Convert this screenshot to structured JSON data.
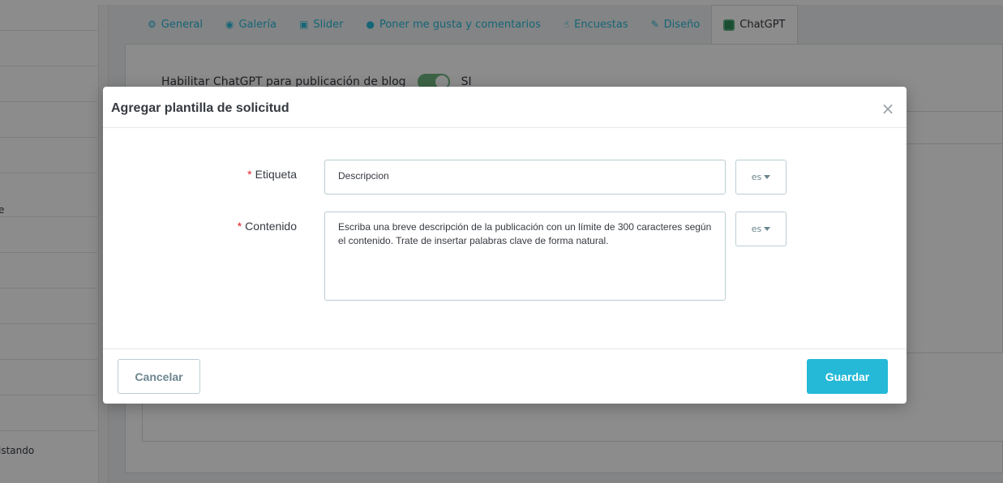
{
  "background": {
    "sidebar_partial_labels": [
      "e",
      "istando"
    ],
    "tabs": [
      {
        "label": "General",
        "icon": "gear-icon"
      },
      {
        "label": "Galería",
        "icon": "camera-icon"
      },
      {
        "label": "Slider",
        "icon": "image-icon"
      },
      {
        "label": "Poner me gusta y comentarios",
        "icon": "comments-icon"
      },
      {
        "label": "Encuestas",
        "icon": "thumbs-up-icon"
      },
      {
        "label": "Diseño",
        "icon": "brush-icon"
      },
      {
        "label": "ChatGPT",
        "icon": "chatgpt-icon"
      }
    ],
    "active_tab": "ChatGPT",
    "enable_label": "Habilitar ChatGPT para publicación de blog",
    "enable_state": "SI"
  },
  "modal": {
    "title": "Agregar plantilla de solicitud",
    "close_glyph": "×",
    "fields": {
      "label_field": {
        "required_mark": "*",
        "label": "Etiqueta",
        "value": "Descripcion",
        "lang": "es"
      },
      "content_field": {
        "required_mark": "*",
        "label": "Contenido",
        "value": "Escriba una breve descripción de la publicación con un límite de 300 caracteres según el contenido. Trate de insertar palabras clave de forma natural.",
        "lang": "es"
      }
    },
    "footer": {
      "cancel_label": "Cancelar",
      "save_label": "Guardar"
    }
  },
  "colors": {
    "accent": "#25b9d7",
    "required": "#e0202b",
    "switch_on": "#70b580"
  }
}
